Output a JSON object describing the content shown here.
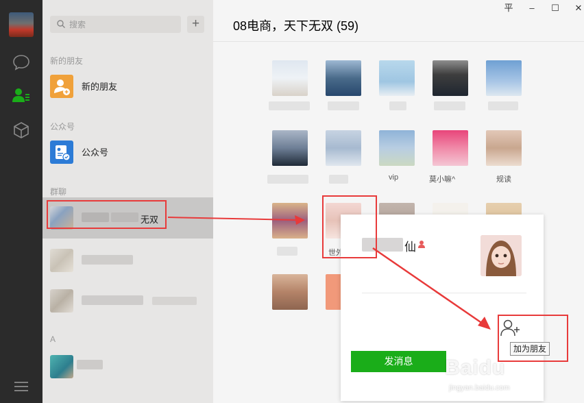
{
  "search": {
    "placeholder": "搜索"
  },
  "toolbar": {
    "add_label": "+"
  },
  "sections": {
    "new_friends": "新的朋友",
    "official": "公众号",
    "groups": "群聊",
    "letter_a": "A"
  },
  "contacts": {
    "new_friends_item": "新的朋友",
    "official_item": "公众号",
    "group_selected_suffix": "无双"
  },
  "chat": {
    "title": "08电商，天下无双 (59)"
  },
  "window_controls": {
    "pin": "平",
    "minimize": "–",
    "maximize": "☐",
    "close": "✕"
  },
  "members": {
    "label_row2_3": "vip",
    "label_row2_4": "莫小嘛^",
    "label_row2_5": "规读",
    "label_row3_2": "世外"
  },
  "card": {
    "name_suffix": "仙",
    "add_friend_tooltip": "加为朋友",
    "send_message": "发消息"
  },
  "watermark": {
    "logo": "Baidu",
    "url": "jingyan.baidu.com"
  },
  "colors": {
    "accent_green": "#1aad19",
    "annotation_red": "#e83a3a",
    "nav_dark": "#2b2b2b",
    "contact_green": "#1aad19"
  }
}
